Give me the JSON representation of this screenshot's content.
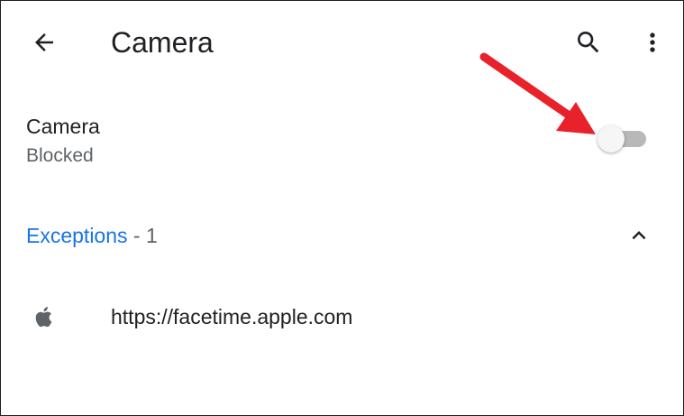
{
  "header": {
    "title": "Camera",
    "back_icon": "arrow-back-icon",
    "search_icon": "search-icon",
    "more_icon": "more-vert-icon"
  },
  "camera_setting": {
    "title": "Camera",
    "summary": "Blocked",
    "toggle_on": false
  },
  "exceptions": {
    "title": "Exceptions",
    "count_text": " - 1",
    "expanded": true,
    "items": [
      {
        "favicon": "apple-logo-icon",
        "url": "https://facetime.apple.com"
      }
    ]
  },
  "annotation": {
    "type": "red-arrow",
    "points_to": "camera-toggle",
    "color": "#e8212b"
  },
  "colors": {
    "accent": "#1a73e8",
    "text_primary": "#202124",
    "text_secondary": "#5f6368",
    "toggle_track_off": "#b8b8b8",
    "toggle_thumb_off": "#f6f6f6",
    "annotation": "#e8212b"
  }
}
